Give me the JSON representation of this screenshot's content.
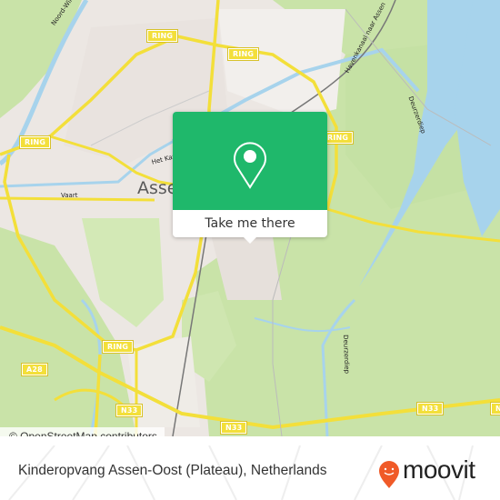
{
  "map": {
    "city_label": "Assen",
    "road_shields": [
      {
        "id": "ring-top-left",
        "text": "RING"
      },
      {
        "id": "ring-top-center",
        "text": "RING"
      },
      {
        "id": "ring-top-right",
        "text": "RING"
      },
      {
        "id": "ring-left",
        "text": "RING"
      },
      {
        "id": "ring-south",
        "text": "RING"
      },
      {
        "id": "a28",
        "text": "A28"
      },
      {
        "id": "n33-west",
        "text": "N33"
      },
      {
        "id": "n33-center",
        "text": "N33"
      },
      {
        "id": "n33-east",
        "text": "N33"
      },
      {
        "id": "n33-far-east",
        "text": "N"
      }
    ],
    "street_labels": {
      "noord_willemskanaal": "Noord-Willemskanaal",
      "havenkanaal": "Havenkanaal naar Assen",
      "deurzerdiep_north": "Deurzerdiep",
      "deurzerdiep_south": "Deurzerdiep",
      "vaart": "Vaart",
      "het_kanaal": "Het Kan"
    },
    "colors": {
      "land": "#ece7e3",
      "green": "#c9e3a8",
      "water": "#a7d3ec",
      "road": "#f3df3a"
    }
  },
  "attribution": "© OpenStreetMap contributors",
  "popup": {
    "icon": "location-pin-icon",
    "button_label": "Take me there",
    "accent": "#1fb86b"
  },
  "footer": {
    "place_name": "Kinderopvang Assen-Oost (Plateau), Netherlands",
    "brand": "moovit",
    "brand_color": "#f05a28"
  }
}
